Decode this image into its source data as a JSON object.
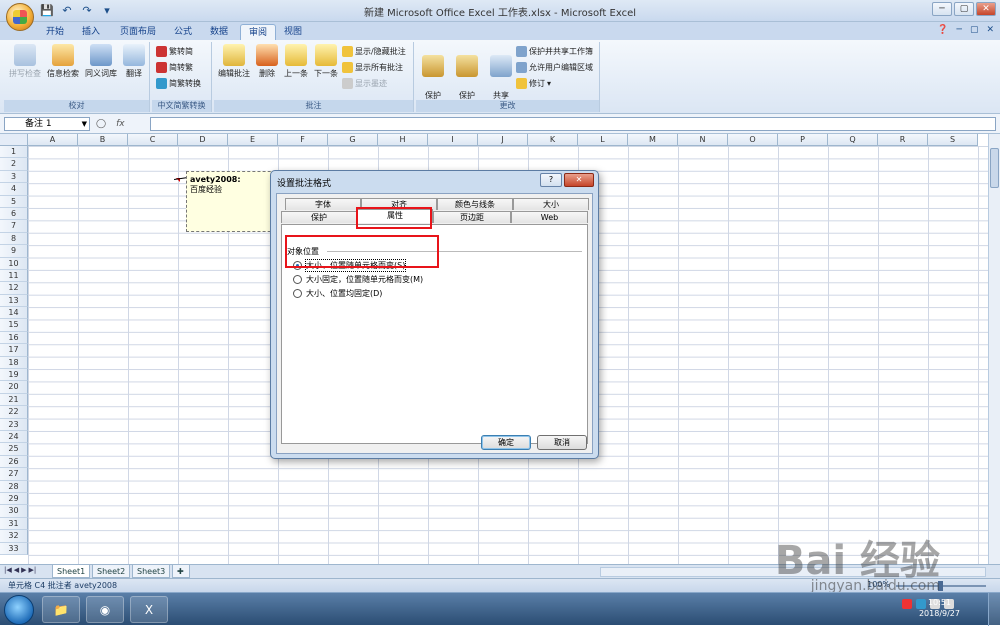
{
  "window": {
    "title": "新建 Microsoft Office Excel 工作表.xlsx - Microsoft Excel",
    "min_btn": "─",
    "max_btn": "▢",
    "close_btn": "✕"
  },
  "ribbon_tabs": [
    "开始",
    "插入",
    "页面布局",
    "公式",
    "数据",
    "审阅",
    "视图"
  ],
  "active_tab": "审阅",
  "ribbon": {
    "proofing": {
      "label": "校对",
      "buttons": [
        "拼写检查",
        "信息检索",
        "同义词库",
        "翻译"
      ]
    },
    "chinese_conversion": {
      "label": "中文简繁转换",
      "buttons": [
        "繁转简",
        "简转繁",
        "简繁转换"
      ]
    },
    "comments": {
      "label": "批注",
      "buttons": [
        "编辑批注",
        "删除",
        "上一条",
        "下一条"
      ],
      "small_buttons": [
        "显示/隐藏批注",
        "显示所有批注",
        "显示墨迹"
      ]
    },
    "changes": {
      "label": "更改",
      "buttons": [
        "保护\n工作表",
        "保护\n工作簿",
        "共享\n工作簿"
      ],
      "small_buttons": [
        "保护并共享工作簿",
        "允许用户编辑区域",
        "修订"
      ]
    }
  },
  "formula_bar": {
    "name_box": "备注 1",
    "fx": "fx",
    "value": ""
  },
  "columns": [
    "A",
    "B",
    "C",
    "D",
    "E",
    "F",
    "G",
    "H",
    "I",
    "J",
    "K",
    "L",
    "M",
    "N",
    "O",
    "P",
    "Q",
    "R",
    "S"
  ],
  "rows": [
    "1",
    "2",
    "3",
    "4",
    "5",
    "6",
    "7",
    "8",
    "9",
    "10",
    "11",
    "12",
    "13",
    "14",
    "15",
    "16",
    "17",
    "18",
    "19",
    "20",
    "21",
    "22",
    "23",
    "24",
    "25",
    "26",
    "27",
    "28",
    "29",
    "30",
    "31",
    "32",
    "33"
  ],
  "comment": {
    "author": "avety2008:",
    "text": "百度经验"
  },
  "dialog": {
    "title": "设置批注格式",
    "help_btn": "?",
    "close_btn": "✕",
    "tabs_row1": [
      "字体",
      "对齐",
      "颜色与线条",
      "大小"
    ],
    "tabs_row2": [
      "保护",
      "属性",
      "页边距",
      "Web"
    ],
    "active_tab": "属性",
    "section": "对象位置",
    "options": [
      {
        "label": "大小、位置随单元格而变(S)",
        "checked": true
      },
      {
        "label": "大小固定，位置随单元格而变(M)",
        "checked": false
      },
      {
        "label": "大小、位置均固定(D)",
        "checked": false
      }
    ],
    "ok": "确定",
    "cancel": "取消"
  },
  "sheets": [
    "Sheet1",
    "Sheet2",
    "Sheet3"
  ],
  "active_sheet": "Sheet1",
  "status": {
    "text": "单元格 C4 批注者 avety2008",
    "zoom": "100%"
  },
  "taskbar": {
    "time": "10:51",
    "date": "2018/9/27"
  },
  "watermark": {
    "main": "Bai 经验",
    "sub": "jingyan.baidu.com"
  },
  "colors": {
    "highlight_red": "#e8141a",
    "comment_bg": "#ffffe1"
  }
}
